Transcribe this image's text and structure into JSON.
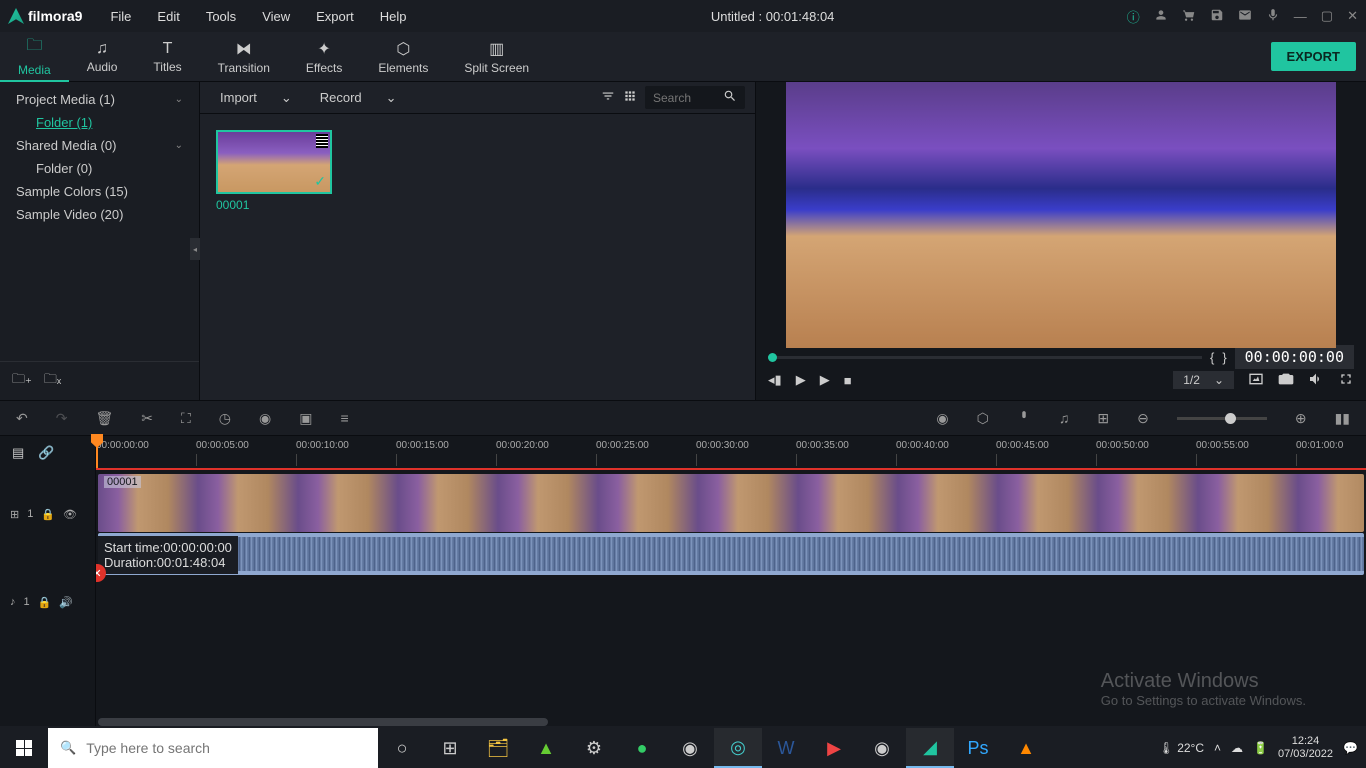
{
  "app": {
    "name": "filmora9",
    "title": "Untitled : 00:01:48:04"
  },
  "menus": [
    "File",
    "Edit",
    "Tools",
    "View",
    "Export",
    "Help"
  ],
  "tabs": [
    {
      "icon": "folder",
      "label": "Media",
      "active": true
    },
    {
      "icon": "music",
      "label": "Audio"
    },
    {
      "icon": "text",
      "label": "Titles"
    },
    {
      "icon": "transition",
      "label": "Transition"
    },
    {
      "icon": "sparkle",
      "label": "Effects"
    },
    {
      "icon": "elements",
      "label": "Elements"
    },
    {
      "icon": "split",
      "label": "Split Screen"
    }
  ],
  "export_label": "EXPORT",
  "sidebar": {
    "items": [
      {
        "label": "Project Media (1)",
        "expandable": true
      },
      {
        "label": "Folder (1)",
        "child": true,
        "selected": true
      },
      {
        "label": "Shared Media (0)",
        "expandable": true
      },
      {
        "label": "Folder (0)",
        "child": true
      },
      {
        "label": "Sample Colors (15)"
      },
      {
        "label": "Sample Video (20)"
      }
    ]
  },
  "browser": {
    "import": "Import",
    "record": "Record",
    "search_placeholder": "Search",
    "clip": {
      "name": "00001"
    }
  },
  "preview": {
    "markers": {
      "in": "{",
      "out": "}"
    },
    "timecode": "00:00:00:00",
    "scale": "1/2"
  },
  "timeline": {
    "ticks": [
      "00:00:00:00",
      "00:00:05:00",
      "00:00:10:00",
      "00:00:15:00",
      "00:00:20:00",
      "00:00:25:00",
      "00:00:30:00",
      "00:00:35:00",
      "00:00:40:00",
      "00:00:45:00",
      "00:00:50:00",
      "00:00:55:00",
      "00:01:00:0"
    ],
    "video_track": {
      "label": "1"
    },
    "audio_track": {
      "label": "1"
    },
    "clip_name": "00001",
    "tooltip": {
      "start": "Start time:00:00:00:00",
      "duration": "Duration:00:01:48:04"
    }
  },
  "watermark": {
    "title": "Activate Windows",
    "sub": "Go to Settings to activate Windows."
  },
  "taskbar": {
    "search_placeholder": "Type here to search",
    "weather": "22°C",
    "time": "12:24",
    "date": "07/03/2022"
  }
}
